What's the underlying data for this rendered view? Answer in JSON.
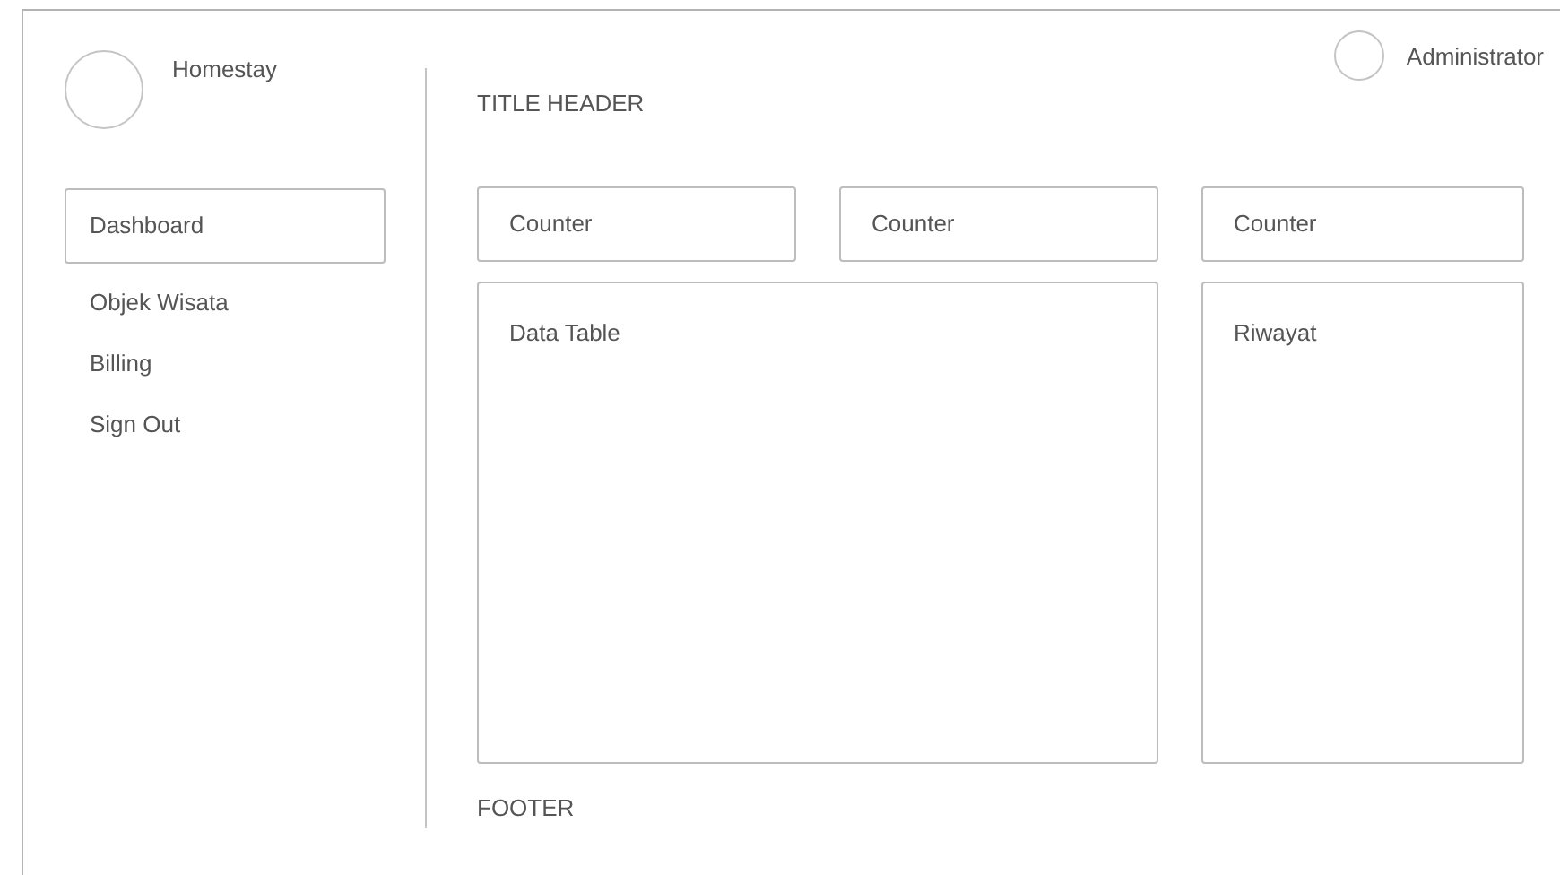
{
  "brand": {
    "name": "Homestay"
  },
  "sidebar": {
    "items": [
      {
        "label": "Dashboard",
        "selected": true
      },
      {
        "label": "Objek Wisata",
        "selected": false
      },
      {
        "label": "Billing",
        "selected": false
      },
      {
        "label": "Sign Out",
        "selected": false
      }
    ]
  },
  "user": {
    "name": "Administrator"
  },
  "title": "TITLE HEADER",
  "counters": [
    "Counter",
    "Counter",
    "Counter"
  ],
  "panels": {
    "main": "Data Table",
    "side": "Riwayat"
  },
  "footer": "FOOTER"
}
